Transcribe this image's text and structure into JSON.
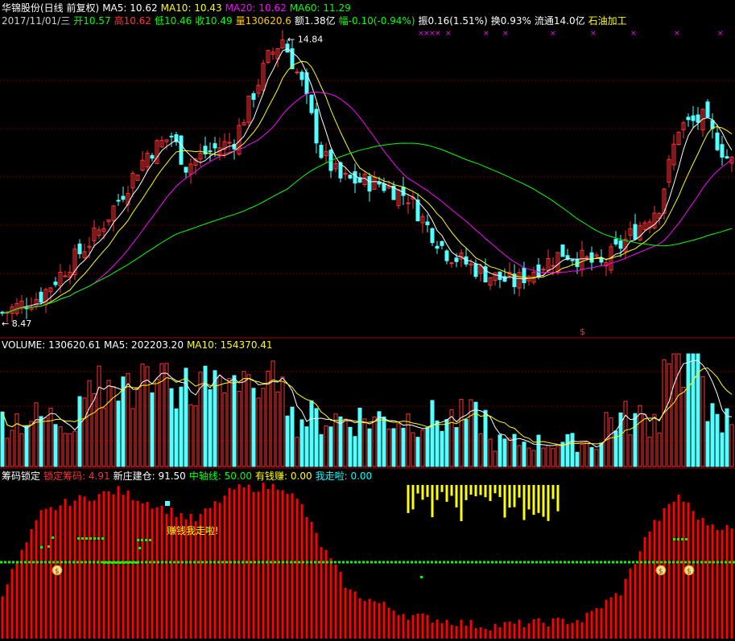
{
  "header": {
    "stock_name": "华锦股份(日线 前复权)",
    "ma5": "MA5: 10.62",
    "ma10": "MA10: 10.43",
    "ma20": "MA20: 10.62",
    "ma60": "MA60: 11.29",
    "date": "2017/11/01/三",
    "open": "开10.57",
    "high": "高10.62",
    "low": "低10.46",
    "close": "收10.49",
    "volume": "量130620.6",
    "amount": "额1.38亿",
    "change": "幅-0.10(-0.94%)",
    "amplitude": "振0.16(1.51%)",
    "turnover": "换0.93%",
    "float_cap": "流通14.0亿",
    "industry": "石油加工"
  },
  "volume_header": {
    "volume": "VOLUME: 130620.61",
    "ma5": "MA5: 202203.20",
    "ma10": "MA10: 154370.41"
  },
  "indicator_header": {
    "name": "筹码锁定",
    "lock": "锁定筹码: 4.91",
    "new_bank": "新庄建仓: 91.50",
    "mid_axis": "中轴线: 50.00",
    "earn": "有钱赚: 0.00",
    "exit": "我走啦: 0.00"
  },
  "annotations": {
    "high_price": "14.84",
    "low_price": "8.47",
    "dollar_marker": "$",
    "signal_text": "赚钱我走啦!",
    "coin": "$"
  },
  "colors": {
    "up": "#ff3232",
    "down": "#54ffff",
    "ma5": "#ffffff",
    "ma10": "#ffff00",
    "ma20": "#ff00ff",
    "ma60": "#00ff00",
    "grid": "#800000",
    "lock": "#ff0000",
    "mid": "#00ff00",
    "exit_bar": "#ffff00"
  },
  "chart_data": [
    {
      "type": "candlestick",
      "title": "华锦股份(日线 前复权)",
      "y_min": 8.47,
      "y_max": 14.84,
      "series": [
        {
          "name": "MA5",
          "value": 10.62
        },
        {
          "name": "MA10",
          "value": 10.43
        },
        {
          "name": "MA20",
          "value": 10.62
        },
        {
          "name": "MA60",
          "value": 11.29
        }
      ],
      "last_bar": {
        "date": "2017/11/01",
        "open": 10.57,
        "high": 10.62,
        "low": 10.46,
        "close": 10.49
      }
    },
    {
      "type": "bar",
      "title": "VOLUME",
      "series": [
        {
          "name": "VOLUME",
          "value": 130620.61
        },
        {
          "name": "MA5",
          "value": 202203.2
        },
        {
          "name": "MA10",
          "value": 154370.41
        }
      ]
    },
    {
      "type": "bar",
      "title": "筹码锁定",
      "series": [
        {
          "name": "锁定筹码",
          "value": 4.91
        },
        {
          "name": "新庄建仓",
          "value": 91.5
        },
        {
          "name": "中轴线",
          "value": 50.0
        },
        {
          "name": "有钱赚",
          "value": 0.0
        },
        {
          "name": "我走啦",
          "value": 0.0
        }
      ]
    }
  ]
}
